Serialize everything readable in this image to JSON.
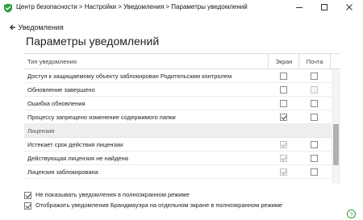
{
  "window": {
    "title": "Центр безопасности > Настройки > Уведомления > Параметры уведомлений",
    "brand_color": "#2e9e3e"
  },
  "nav": {
    "back_label": "Уведомления"
  },
  "page": {
    "title": "Параметры уведомлений"
  },
  "table": {
    "columns": {
      "type": "Тип уведомления",
      "screen": "Экран",
      "mail": "Почта"
    },
    "rows": [
      {
        "kind": "item",
        "label": "Доступ к защищаемому объекту заблокирован Родительским контролем",
        "screen": {
          "checked": false,
          "disabled": false
        },
        "mail": {
          "checked": false,
          "disabled": false
        }
      },
      {
        "kind": "item",
        "label": "Обновление завершено",
        "screen": {
          "checked": false,
          "disabled": false
        },
        "mail": {
          "checked": false,
          "disabled": true
        }
      },
      {
        "kind": "item",
        "label": "Ошибка обновления",
        "screen": {
          "checked": false,
          "disabled": false
        },
        "mail": {
          "checked": false,
          "disabled": false
        }
      },
      {
        "kind": "item",
        "label": "Процессу запрещено изменение содержимого папки",
        "screen": {
          "checked": true,
          "disabled": false
        },
        "mail": {
          "checked": false,
          "disabled": false
        }
      },
      {
        "kind": "group",
        "label": "Лицензия"
      },
      {
        "kind": "item",
        "label": "Истекает срок действия лицензии",
        "screen": {
          "checked": true,
          "disabled": true
        },
        "mail": {
          "checked": false,
          "disabled": false
        }
      },
      {
        "kind": "item",
        "label": "Действующая лицензия не найдена",
        "screen": {
          "checked": true,
          "disabled": true
        },
        "mail": {
          "checked": false,
          "disabled": false
        }
      },
      {
        "kind": "item",
        "label": "Лицензия заблокирована",
        "screen": {
          "checked": true,
          "disabled": true
        },
        "mail": {
          "checked": false,
          "disabled": false
        }
      }
    ]
  },
  "scrollbar": {
    "position_fraction": 0.75,
    "visible_fraction": 0.36
  },
  "options": [
    {
      "label": "Не показывать уведомления в полноэкранном режиме",
      "checked": true
    },
    {
      "label": "Отображать уведомления Брандмауэра на отдельном экране в полноэкранном режиме",
      "checked": true
    }
  ],
  "icons": {
    "app": "shield-icon",
    "back": "arrow-left-icon",
    "help": "help-icon",
    "minimize": "minimize-icon",
    "maximize": "maximize-icon",
    "close": "close-icon"
  }
}
